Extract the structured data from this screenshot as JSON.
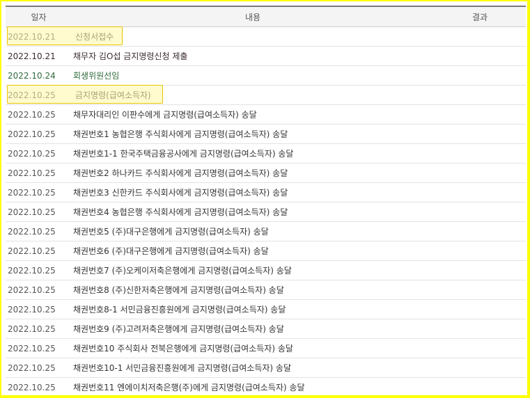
{
  "table": {
    "headers": {
      "date": "일자",
      "content": "내용",
      "result": "결과"
    },
    "rows": [
      {
        "date": "2022.10.21",
        "content": "신청서접수",
        "result": ""
      },
      {
        "date": "2022.10.21",
        "content": "채무자 김O섭 금지명령신청 제출",
        "result": ""
      },
      {
        "date": "2022.10.24",
        "content": "회생위원선임",
        "result": ""
      },
      {
        "date": "2022.10.25",
        "content": "금지명령(급여소득자)",
        "result": ""
      },
      {
        "date": "2022.10.25",
        "content": "채무자대리인 이판수에게 금지명령(급여소득자) 송달",
        "result": ""
      },
      {
        "date": "2022.10.25",
        "content": "채권번호1 농협은행 주식회사에게 금지명령(급여소득자) 송달",
        "result": ""
      },
      {
        "date": "2022.10.25",
        "content": "채권번호1-1 한국주택금융공사에게 금지명령(급여소득자) 송달",
        "result": ""
      },
      {
        "date": "2022.10.25",
        "content": "채권번호2 하나카드 주식회사에게 금지명령(급여소득자) 송달",
        "result": ""
      },
      {
        "date": "2022.10.25",
        "content": "채권번호3 신한카드 주식회사에게 금지명령(급여소득자) 송달",
        "result": ""
      },
      {
        "date": "2022.10.25",
        "content": "채권번호4 농협은행 주식회사에게 금지명령(급여소득자) 송달",
        "result": ""
      },
      {
        "date": "2022.10.25",
        "content": "채권번호5 (주)대구은행에게 금지명령(급여소득자) 송달",
        "result": ""
      },
      {
        "date": "2022.10.25",
        "content": "채권번호6 (주)대구은행에게 금지명령(급여소득자) 송달",
        "result": ""
      },
      {
        "date": "2022.10.25",
        "content": "채권번호7 (주)오케이저축은행에게 금지명령(급여소득자) 송달",
        "result": ""
      },
      {
        "date": "2022.10.25",
        "content": "채권번호8 (주)신한저축은행에게 금지명령(급여소득자) 송달",
        "result": ""
      },
      {
        "date": "2022.10.25",
        "content": "채권번호8-1 서민금융진흥원에게 금지명령(급여소득자) 송달",
        "result": ""
      },
      {
        "date": "2022.10.25",
        "content": "채권번호9 (주)고려저축은행에게 금지명령(급여소득자) 송달",
        "result": ""
      },
      {
        "date": "2022.10.25",
        "content": "채권번호10 주식회사 전북은행에게 금지명령(급여소득자) 송달",
        "result": ""
      },
      {
        "date": "2022.10.25",
        "content": "채권번호10-1 서민금융진흥원에게 금지명령(급여소득자) 송달",
        "result": ""
      },
      {
        "date": "2022.10.25",
        "content": "채권번호11 엔에이치저축은행(주)에게 금지명령(급여소득자) 송달",
        "result": ""
      }
    ]
  },
  "colors": {
    "frame": "#ffff00",
    "highlight_fill": "#fff8a6",
    "highlight_border": "#e8c400",
    "green_text": "#2f6a3b"
  }
}
